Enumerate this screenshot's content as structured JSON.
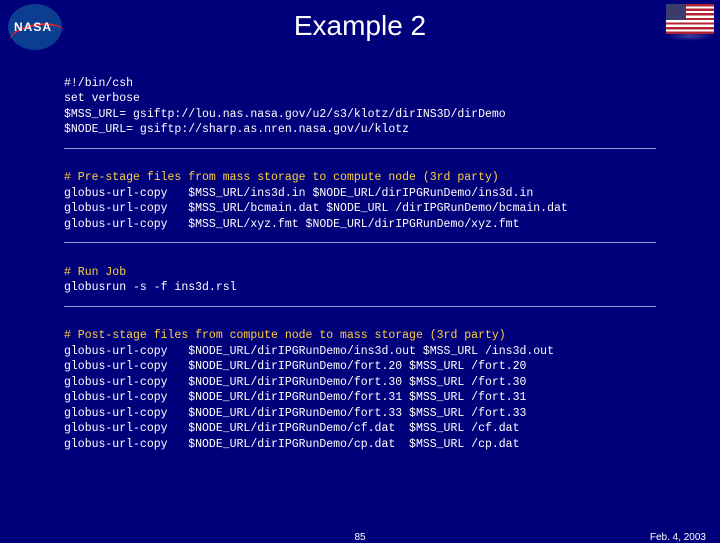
{
  "title": "Example 2",
  "setup_lines": [
    "#!/bin/csh",
    "set verbose",
    "$MSS_URL= gsiftp://lou.nas.nasa.gov/u2/s3/klotz/dirINS3D/dirDemo",
    "$NODE_URL= gsiftp://sharp.as.nren.nasa.gov/u/klotz"
  ],
  "prestage": {
    "comment": "# Pre-stage files from mass storage to compute node (3rd party)",
    "lines": [
      "globus-url-copy   $MSS_URL/ins3d.in $NODE_URL/dirIPGRunDemo/ins3d.in",
      "globus-url-copy   $MSS_URL/bcmain.dat $NODE_URL /dirIPGRunDemo/bcmain.dat",
      "globus-url-copy   $MSS_URL/xyz.fmt $NODE_URL/dirIPGRunDemo/xyz.fmt"
    ]
  },
  "run": {
    "comment": "# Run Job",
    "lines": [
      "globusrun -s -f ins3d.rsl"
    ]
  },
  "poststage": {
    "comment": "# Post-stage files from compute node to mass storage (3rd party)",
    "lines": [
      "globus-url-copy   $NODE_URL/dirIPGRunDemo/ins3d.out $MSS_URL /ins3d.out",
      "globus-url-copy   $NODE_URL/dirIPGRunDemo/fort.20 $MSS_URL /fort.20",
      "globus-url-copy   $NODE_URL/dirIPGRunDemo/fort.30 $MSS_URL /fort.30",
      "globus-url-copy   $NODE_URL/dirIPGRunDemo/fort.31 $MSS_URL /fort.31",
      "globus-url-copy   $NODE_URL/dirIPGRunDemo/fort.33 $MSS_URL /fort.33",
      "globus-url-copy   $NODE_URL/dirIPGRunDemo/cf.dat  $MSS_URL /cf.dat",
      "globus-url-copy   $NODE_URL/dirIPGRunDemo/cp.dat  $MSS_URL /cp.dat"
    ]
  },
  "footer": {
    "page": "85",
    "date": "Feb. 4, 2003"
  },
  "logo": {
    "nasa_text": "NASA"
  }
}
